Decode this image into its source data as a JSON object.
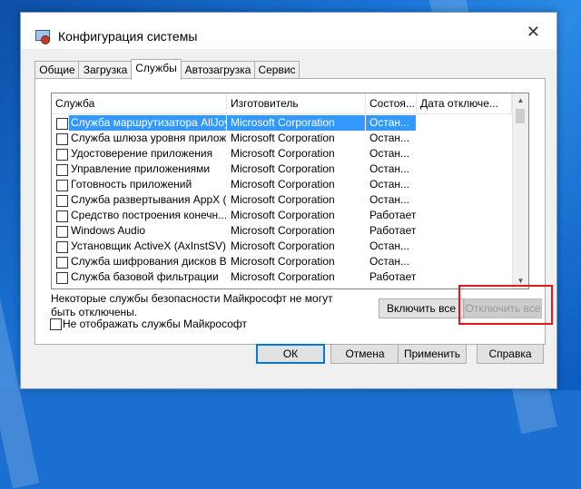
{
  "window": {
    "title": "Конфигурация системы",
    "close_glyph": "✕"
  },
  "tabs": [
    {
      "label": "Общие",
      "active": false
    },
    {
      "label": "Загрузка",
      "active": false
    },
    {
      "label": "Службы",
      "active": true
    },
    {
      "label": "Автозагрузка",
      "active": false
    },
    {
      "label": "Сервис",
      "active": false
    }
  ],
  "services": {
    "columns": [
      "Служба",
      "Изготовитель",
      "Состоя...",
      "Дата отключе..."
    ],
    "rows": [
      {
        "name": "Служба маршрутизатора AllJoyn",
        "vendor": "Microsoft Corporation",
        "status": "Остан...",
        "checked": false,
        "selected": true
      },
      {
        "name": "Служба шлюза уровня прилож...",
        "vendor": "Microsoft Corporation",
        "status": "Остан...",
        "checked": false,
        "selected": false
      },
      {
        "name": "Удостоверение приложения",
        "vendor": "Microsoft Corporation",
        "status": "Остан...",
        "checked": false,
        "selected": false
      },
      {
        "name": "Управление приложениями",
        "vendor": "Microsoft Corporation",
        "status": "Остан...",
        "checked": false,
        "selected": false
      },
      {
        "name": "Готовность приложений",
        "vendor": "Microsoft Corporation",
        "status": "Остан...",
        "checked": false,
        "selected": false
      },
      {
        "name": "Служба развертывания AppX (...",
        "vendor": "Microsoft Corporation",
        "status": "Остан...",
        "checked": false,
        "selected": false
      },
      {
        "name": "Средство построения конечн...",
        "vendor": "Microsoft Corporation",
        "status": "Работает",
        "checked": false,
        "selected": false
      },
      {
        "name": "Windows Audio",
        "vendor": "Microsoft Corporation",
        "status": "Работает",
        "checked": false,
        "selected": false
      },
      {
        "name": "Установщик ActiveX (AxInstSV)",
        "vendor": "Microsoft Corporation",
        "status": "Остан...",
        "checked": false,
        "selected": false
      },
      {
        "name": "Служба шифрования дисков Bi...",
        "vendor": "Microsoft Corporation",
        "status": "Остан...",
        "checked": false,
        "selected": false
      },
      {
        "name": "Служба базовой фильтрации",
        "vendor": "Microsoft Corporation",
        "status": "Работает",
        "checked": false,
        "selected": false
      }
    ]
  },
  "note": "Некоторые службы безопасности Майкрософт не могут быть отключены.",
  "buttons": {
    "enable_all": "Включить все",
    "disable_all": "Отключить все",
    "ok": "ОК",
    "cancel": "Отмена",
    "apply": "Применить",
    "help": "Справка"
  },
  "hide_ms": {
    "label": "Не отображать службы Майкрософт",
    "checked": false
  },
  "colors": {
    "highlight_box": "#e3171e",
    "selection": "#3399ff"
  }
}
